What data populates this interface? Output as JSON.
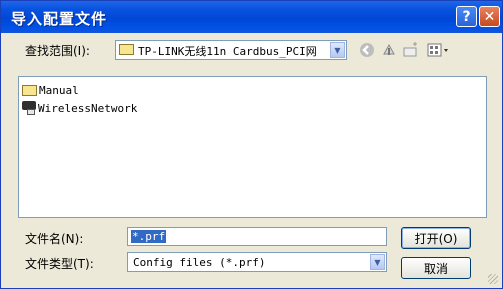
{
  "window": {
    "title": "导入配置文件",
    "help_label": "?",
    "close_label": "✕"
  },
  "look_in": {
    "label": "查找范围(I):",
    "value": "TP-LINK无线11n Cardbus_PCI网"
  },
  "toolbar": {
    "back_icon": "back-icon",
    "up_icon": "up-folder-icon",
    "new_folder_icon": "new-folder-icon",
    "views_icon": "views-menu-icon"
  },
  "files": [
    {
      "name": "Manual",
      "icon": "folder-icon"
    },
    {
      "name": "WirelessNetwork",
      "icon": "network-folder-icon"
    }
  ],
  "filename": {
    "label": "文件名(N):",
    "value": "*.prf"
  },
  "filetype": {
    "label": "文件类型(T):",
    "value": "Config files (*.prf)"
  },
  "buttons": {
    "open": "打开(O)",
    "cancel": "取消"
  }
}
